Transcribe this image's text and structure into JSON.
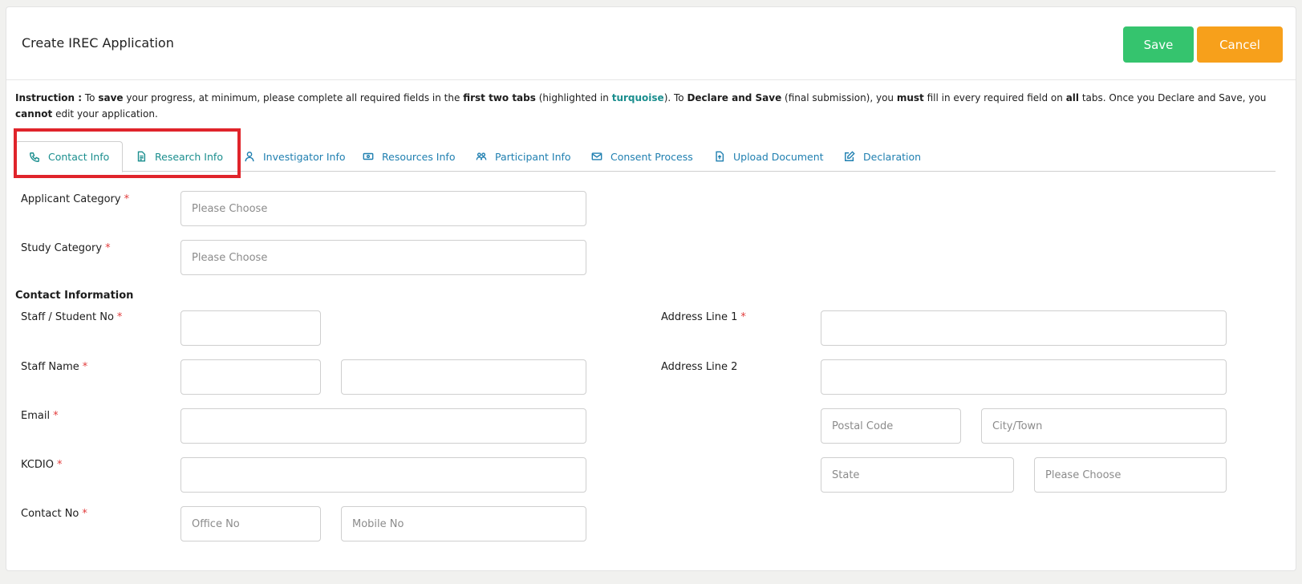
{
  "header": {
    "title": "Create IREC Application",
    "save_label": "Save",
    "cancel_label": "Cancel",
    "save_color": "#35c46e",
    "cancel_color": "#f7a01b"
  },
  "instruction": {
    "label": "Instruction :",
    "t1": " To ",
    "b1": "save",
    "t2": " your progress, at minimum, please complete all required fields in the ",
    "b2": "first two tabs",
    "t3": " (highlighted in ",
    "turq": "turquoise",
    "t4": "). To ",
    "b3": "Declare and Save",
    "t5": " (final submission), you ",
    "b4": "must",
    "t6": " fill in every required field on ",
    "b5": "all",
    "t7": " tabs. Once you Declare and Save, you ",
    "b6": "cannot",
    "t8": " edit your application."
  },
  "tabs": [
    {
      "label": "Contact Info",
      "icon": "phone-icon"
    },
    {
      "label": "Research Info",
      "icon": "document-icon"
    },
    {
      "label": "Investigator Info",
      "icon": "user-icon"
    },
    {
      "label": "Resources Info",
      "icon": "money-icon"
    },
    {
      "label": "Participant Info",
      "icon": "people-icon"
    },
    {
      "label": "Consent Process",
      "icon": "envelope-icon"
    },
    {
      "label": "Upload Document",
      "icon": "upload-file-icon"
    },
    {
      "label": "Declaration",
      "icon": "edit-icon"
    }
  ],
  "form": {
    "applicant_category": {
      "label": "Applicant Category",
      "placeholder": "Please Choose"
    },
    "study_category": {
      "label": "Study Category",
      "placeholder": "Please Choose"
    },
    "section_contact": "Contact Information",
    "staff_no": {
      "label": "Staff / Student No",
      "value": ""
    },
    "staff_name": {
      "label": "Staff Name"
    },
    "email": {
      "label": "Email"
    },
    "kcdio": {
      "label": "KCDIO"
    },
    "contact_no": {
      "label": "Contact No",
      "office_placeholder": "Office No",
      "mobile_placeholder": "Mobile No"
    },
    "address1": {
      "label": "Address Line 1"
    },
    "address2": {
      "label": "Address Line 2"
    },
    "postal_code": {
      "placeholder": "Postal Code"
    },
    "city": {
      "placeholder": "City/Town"
    },
    "state": {
      "placeholder": "State"
    },
    "country": {
      "placeholder": "Please Choose"
    },
    "required_mark": "*"
  },
  "accent_colors": {
    "turquoise": "#1a8e8e",
    "tab_blue": "#1f7fb0",
    "highlight_red": "#e0242b"
  }
}
